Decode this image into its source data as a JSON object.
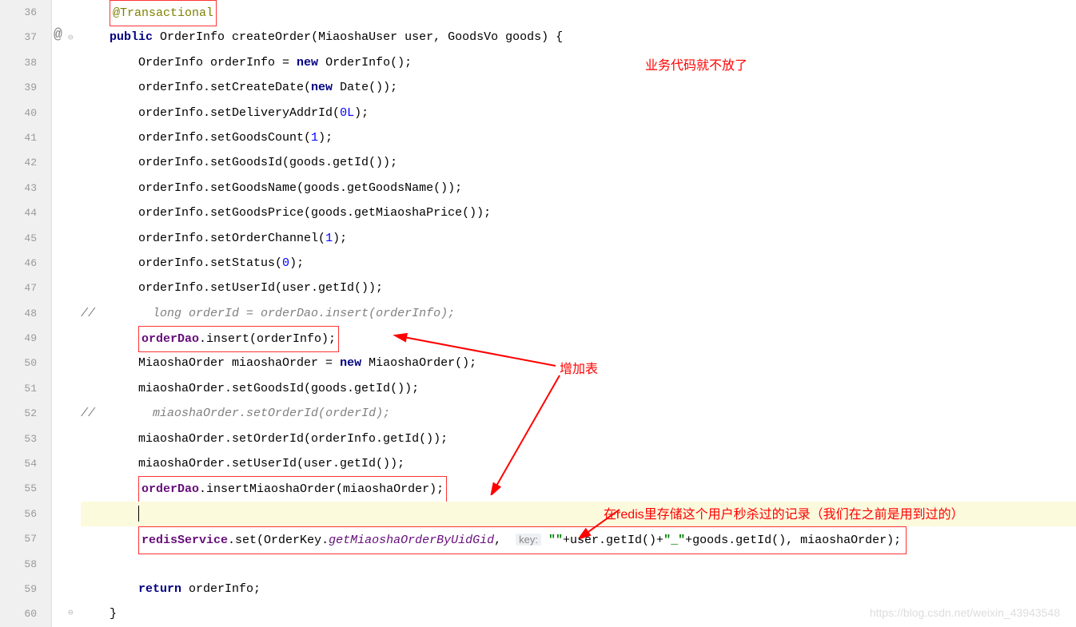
{
  "lineNumbers": [
    "36",
    "37",
    "38",
    "39",
    "40",
    "41",
    "42",
    "43",
    "44",
    "45",
    "46",
    "47",
    "48",
    "49",
    "50",
    "51",
    "52",
    "53",
    "54",
    "55",
    "56",
    "57",
    "58",
    "59",
    "60"
  ],
  "annotations": {
    "note1": "业务代码就不放了",
    "note2": "增加表",
    "note3": "在redis里存储这个用户秒杀过的记录（我们在之前是用到过的）"
  },
  "code": {
    "l36_ann": "@Transactional",
    "l37_kw1": "public",
    "l37_sig": " OrderInfo createOrder(MiaoshaUser user, GoodsVo goods) {",
    "l38_a": "        OrderInfo orderInfo = ",
    "l38_kw": "new",
    "l38_b": " OrderInfo();",
    "l39_a": "        orderInfo.setCreateDate(",
    "l39_kw": "new",
    "l39_b": " Date());",
    "l40": "        orderInfo.setDeliveryAddrId(",
    "l40_n": "0L",
    "l40_e": ");",
    "l41": "        orderInfo.setGoodsCount(",
    "l41_n": "1",
    "l41_e": ");",
    "l42": "        orderInfo.setGoodsId(goods.getId());",
    "l43": "        orderInfo.setGoodsName(goods.getGoodsName());",
    "l44": "        orderInfo.setGoodsPrice(goods.getMiaoshaPrice());",
    "l45": "        orderInfo.setOrderChannel(",
    "l45_n": "1",
    "l45_e": ");",
    "l46": "        orderInfo.setStatus(",
    "l46_n": "0",
    "l46_e": ");",
    "l47": "        orderInfo.setUserId(user.getId());",
    "l48_sl": "//",
    "l48_c": "        long orderId = orderDao.insert(orderInfo);",
    "l49_pre": "        ",
    "l49_f": "orderDao",
    "l49_b": ".insert(orderInfo);",
    "l50_a": "        MiaoshaOrder miaoshaOrder = ",
    "l50_kw": "new",
    "l50_b": " MiaoshaOrder();",
    "l51": "        miaoshaOrder.setGoodsId(goods.getId());",
    "l52_sl": "//",
    "l52_c": "        miaoshaOrder.setOrderId(orderId);",
    "l53": "        miaoshaOrder.setOrderId(orderInfo.getId());",
    "l54": "        miaoshaOrder.setUserId(user.getId());",
    "l55_pre": "        ",
    "l55_f": "orderDao",
    "l55_b": ".insertMiaoshaOrder(miaoshaOrder);",
    "l57_pre": "        ",
    "l57_f": "redisService",
    "l57_a": ".set(OrderKey.",
    "l57_m": "getMiaoshaOrderByUidGid",
    "l57_c": ", ",
    "l57_hint": "key:",
    "l57_s1": "\"\"",
    "l57_d": "+user.getId()+",
    "l57_s2": "\"_\"",
    "l57_e": "+goods.getId(), miaoshaOrder);",
    "l59_kw": "return",
    "l59_b": " orderInfo;",
    "l60": "    }"
  },
  "markers": {
    "at": "@"
  },
  "watermark": "https://blog.csdn.net/weixin_43943548"
}
